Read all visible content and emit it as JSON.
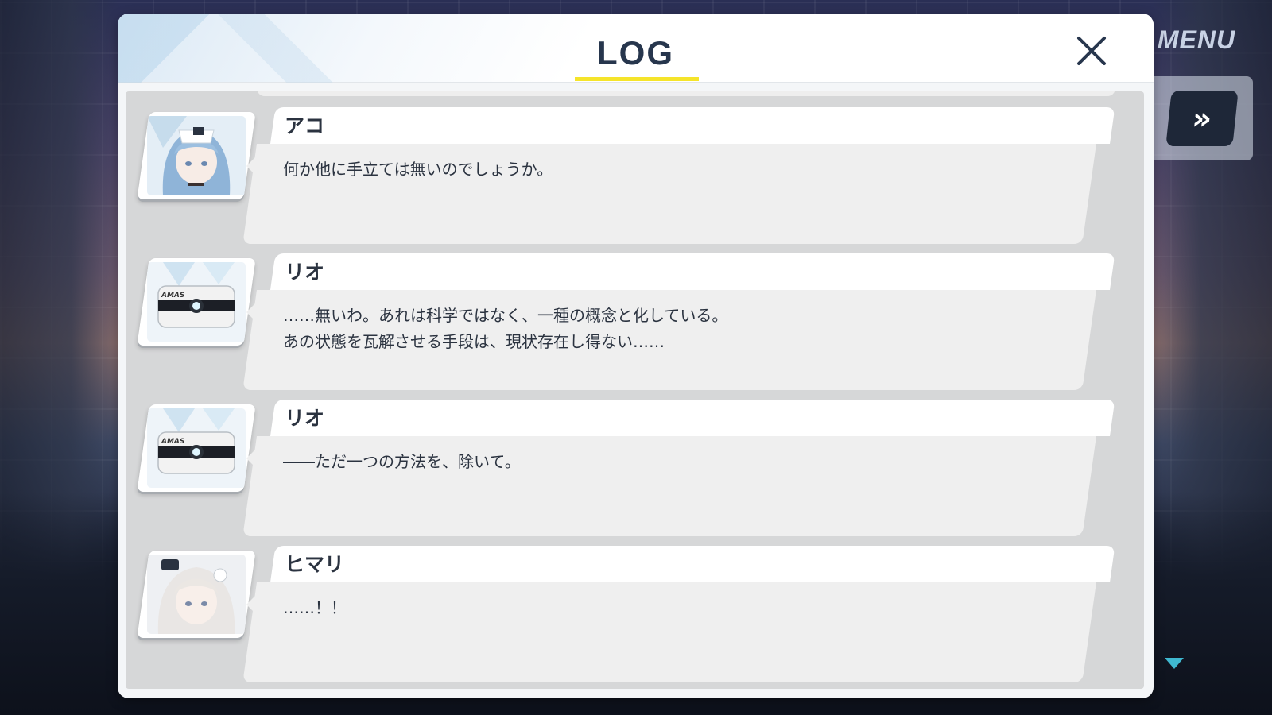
{
  "game_controls": {
    "menu_label": "MENU",
    "fast_forward_glyph": "»",
    "fast_forward_icon": "fast-forward-icon",
    "scroll_icon": "scroll-down-triangle-icon"
  },
  "log": {
    "title": "LOG",
    "close_icon": "close-icon",
    "accent_color": "#f5e42a",
    "title_color": "#27364d",
    "entries": [
      {
        "speaker": "アコ",
        "portrait": "ako-portrait",
        "lines": [
          "何か他に手立ては無いのでしょうか。"
        ]
      },
      {
        "speaker": "リオ",
        "portrait": "amas-device-portrait",
        "portrait_text": "AMAS",
        "lines": [
          "……無いわ。あれは科学ではなく、一種の概念と化している。",
          "あの状態を瓦解させる手段は、現状存在し得ない……"
        ]
      },
      {
        "speaker": "リオ",
        "portrait": "amas-device-portrait",
        "portrait_text": "AMAS",
        "lines": [
          "――ただ一つの方法を、除いて。"
        ]
      },
      {
        "speaker": "ヒマリ",
        "portrait": "himari-portrait",
        "lines": [
          "……！！"
        ]
      }
    ]
  }
}
